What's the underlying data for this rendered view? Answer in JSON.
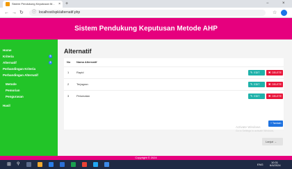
{
  "browser": {
    "tab_title": "Sistem Pendukung Keputusan M...",
    "tab_close": "×",
    "new_tab": "+",
    "url": "localhost/spk/alternatif.php",
    "win_min": "−",
    "win_close": "×"
  },
  "header": {
    "title": "Sistem Pendukung Keputusan Metode AHP"
  },
  "sidebar": {
    "items": [
      {
        "label": "Home"
      },
      {
        "label": "Kriteria",
        "badge": "5"
      },
      {
        "label": "Alternatif",
        "badge": "3"
      },
      {
        "label": "Perbandingan Kriteria"
      },
      {
        "label": "Perbandingan Alternatif"
      },
      {
        "label": "Metode"
      },
      {
        "label": "Pemorian"
      },
      {
        "label": "Pengurasan"
      },
      {
        "label": "Hasil"
      }
    ]
  },
  "main": {
    "title": "Alternatif",
    "table": {
      "columns": [
        "No",
        "Nama Alternatif"
      ],
      "rows": [
        {
          "no": "1",
          "name": "Rapid"
        },
        {
          "no": "2",
          "name": "Terjagran"
        },
        {
          "no": "3",
          "name": "Pelumatan"
        }
      ],
      "edit_label": "EDIT",
      "delete_label": "DELETE"
    },
    "add_label": "Tambah",
    "next_label": "Lanjut"
  },
  "watermark": {
    "line1": "Activate Windows",
    "line2": "Go to Settings to activate Windows."
  },
  "footer": {
    "text": "Copyright © 2024"
  },
  "taskbar": {
    "tray_lang": "ENG",
    "tray_time": "10:31",
    "tray_date": "6/4/2024"
  },
  "colors": {
    "header": "#e6007e",
    "sidebar": "#22c428",
    "edit": "#20b2aa",
    "delete": "#e8173b",
    "add": "#1e72e0"
  }
}
